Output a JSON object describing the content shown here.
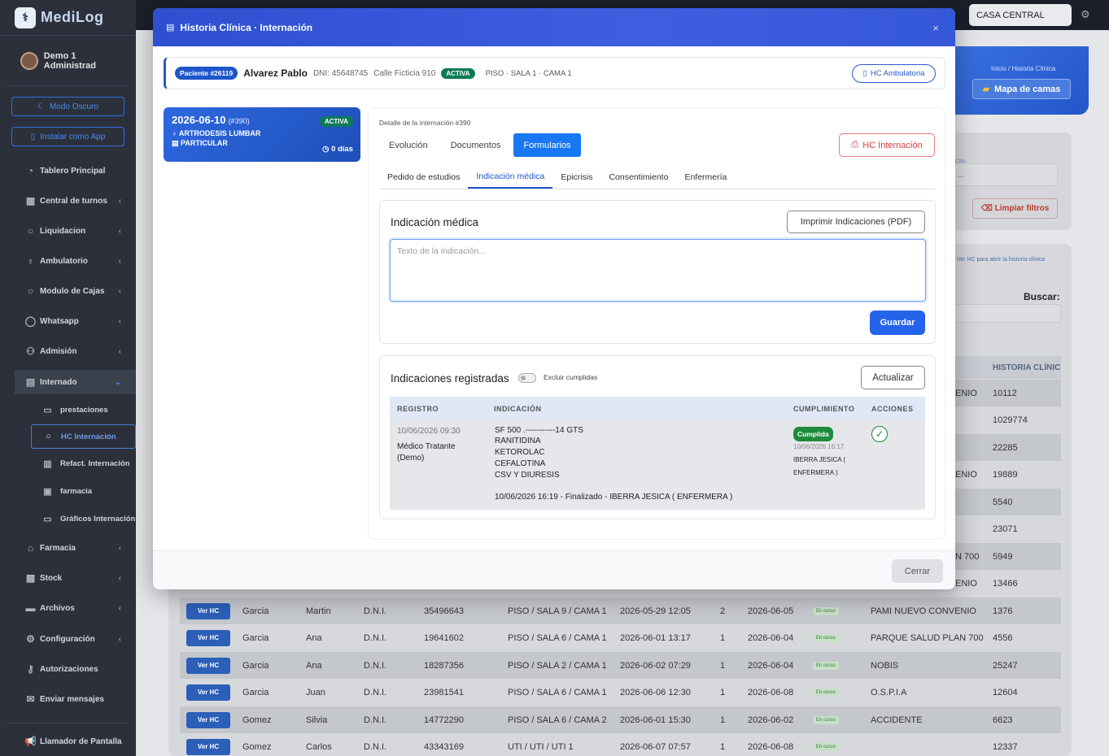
{
  "app": {
    "title": "MediLog",
    "user": "Demo 1 Administrad",
    "dark_mode": "Modo Oscuro",
    "install": "Instalar como App"
  },
  "sidebar": {
    "items": [
      {
        "label": "Tablero Principal"
      },
      {
        "label": "Central de turnos"
      },
      {
        "label": "Liquidacion"
      },
      {
        "label": "Ambulatorio"
      },
      {
        "label": "Modulo de Cajas"
      },
      {
        "label": "Whatsapp"
      },
      {
        "label": "Admisión"
      },
      {
        "label": "Internado"
      },
      {
        "label": "Farmacia"
      },
      {
        "label": "Stock"
      },
      {
        "label": "Archivos"
      },
      {
        "label": "Configuración"
      },
      {
        "label": "Autorizaciones"
      },
      {
        "label": "Enviar mensajes"
      },
      {
        "label": "Llamador de Pantalla"
      }
    ],
    "sub": [
      {
        "label": "prestaciones"
      },
      {
        "label": "HC Internación"
      },
      {
        "label": "Refact. Internación"
      },
      {
        "label": "farmacia"
      },
      {
        "label": "Gráficos Internación"
      }
    ]
  },
  "topbar": {
    "location": "CASA CENTRAL"
  },
  "background": {
    "breadcrumb": "Inicio / Historia Clínica",
    "mapa": "Mapa de camas",
    "cial": "CIAL",
    "limpiar": "Limpiar filtros",
    "verhc_note": "Ver HC para abrir la historia clínica",
    "buscar": "Buscar:",
    "th_hc": "HISTORIA CLÍNIC",
    "partial_rows": [
      {
        "c1": "ENIO",
        "hc": "10112"
      },
      {
        "c1": "",
        "hc": "1029774"
      },
      {
        "c1": "",
        "hc": "22285"
      },
      {
        "c1": "ENIO",
        "hc": "19889"
      },
      {
        "c1": "",
        "hc": "5540"
      },
      {
        "c1": "",
        "hc": "23071"
      },
      {
        "c1": "N 700",
        "hc": "5949"
      },
      {
        "c1": "ENIO",
        "hc": "13466"
      }
    ],
    "rows": [
      {
        "btn": "Ver HC",
        "ap": "Garcia",
        "no": "Martin",
        "doc": "D.N.I.",
        "num": "35496643",
        "loc": "PISO / SALA 9 / CAMA 1",
        "ing": "2026-05-29 12:05",
        "n": "2",
        "fec": "2026-06-05",
        "est": "En curso",
        "os": "PAMI NUEVO CONVENIO",
        "hc": "1376"
      },
      {
        "btn": "Ver HC",
        "ap": "Garcia",
        "no": "Ana",
        "doc": "D.N.I.",
        "num": "19641602",
        "loc": "PISO / SALA 6 / CAMA 1",
        "ing": "2026-06-01 13:17",
        "n": "1",
        "fec": "2026-06-04",
        "est": "En curso",
        "os": "PARQUE SALUD PLAN 700",
        "hc": "4556"
      },
      {
        "btn": "Ver HC",
        "ap": "Garcia",
        "no": "Ana",
        "doc": "D.N.I.",
        "num": "18287356",
        "loc": "PISO / SALA 2 / CAMA 1",
        "ing": "2026-06-02 07:29",
        "n": "1",
        "fec": "2026-06-04",
        "est": "En curso",
        "os": "NOBIS",
        "hc": "25247"
      },
      {
        "btn": "Ver HC",
        "ap": "Garcia",
        "no": "Juan",
        "doc": "D.N.I.",
        "num": "23981541",
        "loc": "PISO / SALA 6 / CAMA 1",
        "ing": "2026-06-06 12:30",
        "n": "1",
        "fec": "2026-06-08",
        "est": "En curso",
        "os": "O.S.P.I.A",
        "hc": "12604"
      },
      {
        "btn": "Ver HC",
        "ap": "Gomez",
        "no": "Silvia",
        "doc": "D.N.I.",
        "num": "14772290",
        "loc": "PISO / SALA 6 / CAMA 2",
        "ing": "2026-06-01 15:30",
        "n": "1",
        "fec": "2026-06-02",
        "est": "En curso",
        "os": "ACCIDENTE",
        "hc": "6623"
      },
      {
        "btn": "Ver HC",
        "ap": "Gomez",
        "no": "Carlos",
        "doc": "D.N.I.",
        "num": "43343169",
        "loc": "UTI / UTI / UTI 1",
        "ing": "2026-06-07 07:57",
        "n": "1",
        "fec": "2026-06-08",
        "est": "En curso",
        "os": "",
        "hc": "12337"
      }
    ]
  },
  "modal": {
    "title": "Historia Clínica · Internación",
    "close_x": "×",
    "patient": {
      "badge": "Paciente #26119",
      "name": "Alvarez Pablo",
      "dni": "DNI: 45648745",
      "address": "Calle Ficticia 910",
      "status": "ACTIVA",
      "location": "PISO · SALA 1 · CAMA 1",
      "hc_amb": "HC Ambulatoria"
    },
    "stay": {
      "date": "2026-06-10",
      "id": "(#390)",
      "status": "ACTIVA",
      "diagnosis": "ARTRODESIS LUMBAR",
      "coverage": "PARTICULAR",
      "days": "0 días"
    },
    "detail_title": "Detalle de la internación #390",
    "tabs": [
      "Evolución",
      "Documentos",
      "Formularios"
    ],
    "hc_int": "HC Internación",
    "subtabs": [
      "Pedido de estudios",
      "Indicación médica",
      "Epicrisis",
      "Consentimiento",
      "Enfermería"
    ],
    "indicacion": {
      "title": "Indicación médica",
      "print": "Imprimir Indicaciones (PDF)",
      "placeholder": "Texto de la indicación...",
      "save": "Guardar"
    },
    "registradas": {
      "title": "Indicaciones registradas",
      "exclude": "Excluir cumplidas",
      "update": "Actualizar",
      "headers": [
        "REGISTRO",
        "INDICACIÓN",
        "CUMPLIMIENTO",
        "ACCIONES"
      ],
      "row": {
        "date": "10/06/2026 09:30",
        "doctor1": "Médico Tratante",
        "doctor2": "(Demo)",
        "lines": [
          "SF 500 .-----------14 GTS",
          "RANITIDINA",
          "KETOROLAC",
          "CEFALOTINA",
          "CSV Y DIURESIS"
        ],
        "final": "10/06/2026 16:19 - Finalizado - IBERRA JESICA ( ENFERMERA )",
        "badge": "Cumplida",
        "c_date": "10/06/2026 16:17",
        "c_who1": "IBERRA JESICA (",
        "c_who2": "ENFERMERA )",
        "check": "✓"
      }
    },
    "close": "Cerrar"
  }
}
